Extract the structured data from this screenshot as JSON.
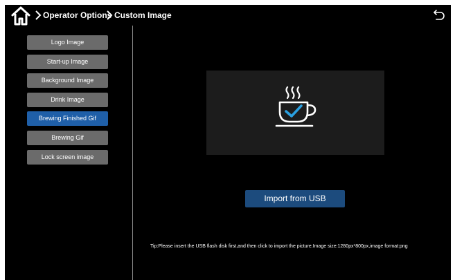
{
  "header": {
    "home_icon": "home-icon",
    "crumb_separator_icon": "chevron-right-icon",
    "crumb_1": "Operator Options",
    "crumb_2": "Custom Image",
    "back_icon": "back-arrow-icon"
  },
  "sidebar": {
    "items": [
      {
        "label": "Logo Image",
        "active": false
      },
      {
        "label": "Start-up Image",
        "active": false
      },
      {
        "label": "Background Image",
        "active": false
      },
      {
        "label": "Drink Image",
        "active": false
      },
      {
        "label": "Brewing Finished Gif",
        "active": true
      },
      {
        "label": "Brewing Gif",
        "active": false
      },
      {
        "label": "Lock screen image",
        "active": false
      }
    ]
  },
  "main": {
    "preview_icon": "coffee-cup-check-icon",
    "import_label": "Import from USB",
    "tip": "Tip:Please insert the USB flash disk first,and then click to import the picture.Image size:1280px*800px,image format:png"
  },
  "colors": {
    "background": "#000000",
    "button_gray": "#6b6b6b",
    "active_blue": "#1f5fa8",
    "import_blue": "#1c4b7d",
    "check_blue": "#2aa0e0"
  }
}
